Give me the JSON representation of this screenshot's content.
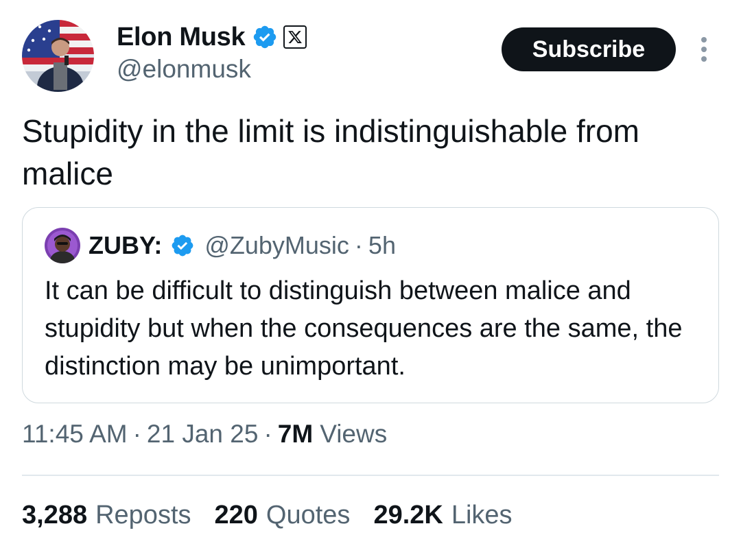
{
  "author": {
    "name": "Elon Musk",
    "handle": "@elonmusk",
    "verified_color": "#1d9bf0",
    "org_badge_icon": "x-logo-icon"
  },
  "actions": {
    "subscribe_label": "Subscribe",
    "more_icon": "more-vertical-icon"
  },
  "tweet": {
    "text": "Stupidity in the limit is indistinguishable from malice"
  },
  "quote": {
    "name": "ZUBY:",
    "handle": "@ZubyMusic",
    "separator": "·",
    "time": "5h",
    "text": "It can be difficult to distinguish between malice and stupidity but when the consequences are the same, the distinction may be unimportant."
  },
  "meta": {
    "time": "11:45 AM",
    "separator": "·",
    "date": "21 Jan 25",
    "views_count": "7M",
    "views_label": "Views"
  },
  "stats": [
    {
      "count": "3,288",
      "label": "Reposts"
    },
    {
      "count": "220",
      "label": "Quotes"
    },
    {
      "count": "29.2K",
      "label": "Likes"
    }
  ],
  "colors": {
    "text_primary": "#0f1419",
    "text_secondary": "#536471",
    "border": "#cfd9de",
    "accent": "#1d9bf0"
  }
}
